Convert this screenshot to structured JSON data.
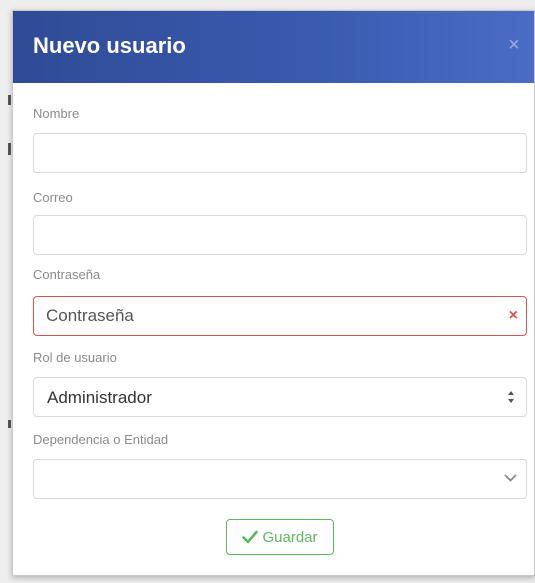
{
  "modal": {
    "title": "Nuevo usuario",
    "close_label": "×"
  },
  "fields": {
    "nombre": {
      "label": "Nombre",
      "value": "",
      "placeholder": ""
    },
    "correo": {
      "label": "Correo",
      "value": "",
      "placeholder": ""
    },
    "contrasena": {
      "label": "Contraseña",
      "value": "",
      "placeholder": "Contraseña",
      "error_icon": "×"
    },
    "rol": {
      "label": "Rol de usuario",
      "selected": "Administrador"
    },
    "dependencia": {
      "label": "Dependencia o Entidad",
      "selected": ""
    }
  },
  "actions": {
    "save_label": "Guardar"
  },
  "colors": {
    "header": "#3a5bb0",
    "error": "#d9534f",
    "success": "#5cb85c"
  },
  "icons": {
    "close": "close-icon",
    "error": "error-x-icon",
    "select_arrows": "sort-arrows-icon",
    "dropdown": "chevron-down-icon",
    "save": "check-icon"
  }
}
